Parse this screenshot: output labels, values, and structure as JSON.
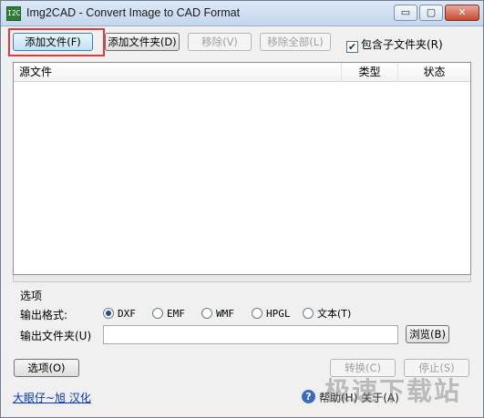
{
  "window": {
    "title": "Img2CAD - Convert Image to CAD Format",
    "app_icon_text": "I2C",
    "min_glyph": "▭",
    "max_glyph": "▢",
    "close_glyph": "✕"
  },
  "toolbar": {
    "add_file": "添加文件(F)",
    "add_folder": "添加文件夹(D)",
    "remove": "移除(V)",
    "remove_all": "移除全部(L)",
    "include_subfolders": "包含子文件夹(R)",
    "include_subfolders_checked": true
  },
  "list": {
    "columns": [
      "源文件",
      "类型",
      "状态"
    ]
  },
  "options": {
    "group_label": "选项",
    "format_label": "输出格式:",
    "formats": [
      {
        "label": "DXF",
        "selected": true
      },
      {
        "label": "EMF",
        "selected": false
      },
      {
        "label": "WMF",
        "selected": false
      },
      {
        "label": "HPGL",
        "selected": false
      },
      {
        "label": "文本(T)",
        "selected": false
      }
    ],
    "folder_label": "输出文件夹(U)",
    "folder_value": "",
    "browse": "浏览(B)"
  },
  "bottom": {
    "options_button": "选项(O)",
    "convert": "转换(C)",
    "stop": "停止(S)",
    "credit_link": "大眼仔~旭 汉化",
    "help_glyph": "?",
    "help_text": "帮助(H) 关于(A)"
  },
  "watermark": "极速下载站",
  "colors": {
    "highlight": "#e23b3b",
    "link": "#0033cc"
  }
}
